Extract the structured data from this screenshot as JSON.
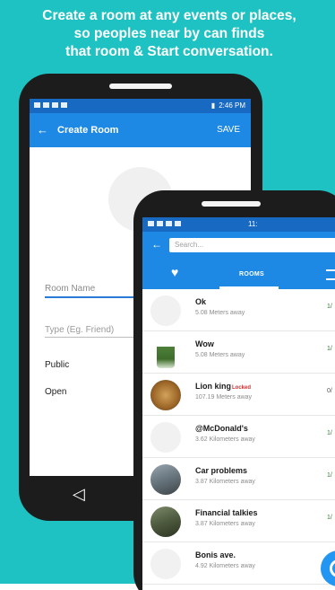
{
  "headline": {
    "line1": "Create a room at any events or places,",
    "line2": "so peoples near by can finds",
    "line3": "that room & Start conversation."
  },
  "phone1": {
    "status_time": "2:46 PM",
    "toolbar": {
      "back_icon": "arrow-left-icon",
      "title": "Create Room",
      "save_label": "SAVE"
    },
    "form": {
      "room_name_placeholder": "Room Name",
      "type_placeholder": "Type (Eg. Friend)",
      "option_public": "Public",
      "option_open": "Open"
    },
    "nav_back_icon": "triangle-back-icon"
  },
  "phone2": {
    "status_time": "11:",
    "search_placeholder": "Search...",
    "tabs": {
      "rooms_label": "ROOMS",
      "heart_icon": "heart-icon",
      "menu_icon": "menu-icon"
    },
    "rooms": [
      {
        "name": "Ok",
        "locked": "",
        "distance": "5.08 Meters away",
        "count": "1/"
      },
      {
        "name": "Wow",
        "locked": "",
        "distance": "5.08 Meters away",
        "count": "1/"
      },
      {
        "name": "Lion king",
        "locked": "Locked",
        "distance": "107.19 Meters away",
        "count": "0/"
      },
      {
        "name": "@McDonald's",
        "locked": "",
        "distance": "3.62 Kilometers away",
        "count": "1/"
      },
      {
        "name": "Car problems",
        "locked": "",
        "distance": "3.87 Kilometers away",
        "count": "1/"
      },
      {
        "name": "Financial talkies",
        "locked": "",
        "distance": "3.87 Kilometers away",
        "count": "1/"
      },
      {
        "name": "Bonis ave.",
        "locked": "",
        "distance": "4.92 Kilometers away",
        "count": ""
      }
    ]
  },
  "colors": {
    "background": "#1fc2c2",
    "toolbar": "#1e88e5",
    "statusbar": "#1769c1",
    "locked": "#e02a2a"
  }
}
